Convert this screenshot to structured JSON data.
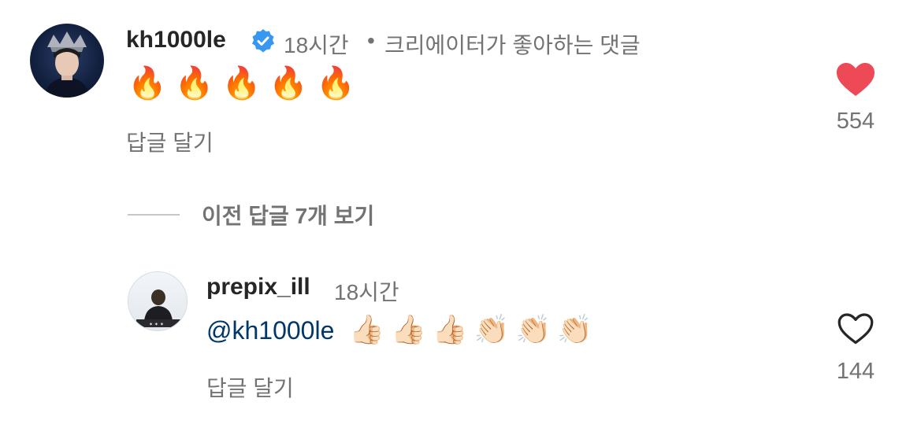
{
  "comment": {
    "username": "kh1000le",
    "time": "18시간",
    "separator": "•",
    "creator_liked": "크리에이터가 좋아하는 댓글",
    "text": "🔥🔥🔥🔥🔥",
    "reply_label": "답글 달기",
    "like_count": "554",
    "liked": true,
    "like_color": "#ed4956"
  },
  "view_previous_replies": "이전 답글 7개 보기",
  "reply": {
    "username": "prepix_ill",
    "time": "18시간",
    "mention": "@kh1000le",
    "text": "👍🏻👍🏻👍🏻👏🏻👏🏻👏🏻",
    "reply_label": "답글 달기",
    "like_count": "144",
    "liked": false
  },
  "colors": {
    "verified_badge": "#3897f0",
    "mention": "#00376b",
    "secondary_text": "#737373"
  }
}
